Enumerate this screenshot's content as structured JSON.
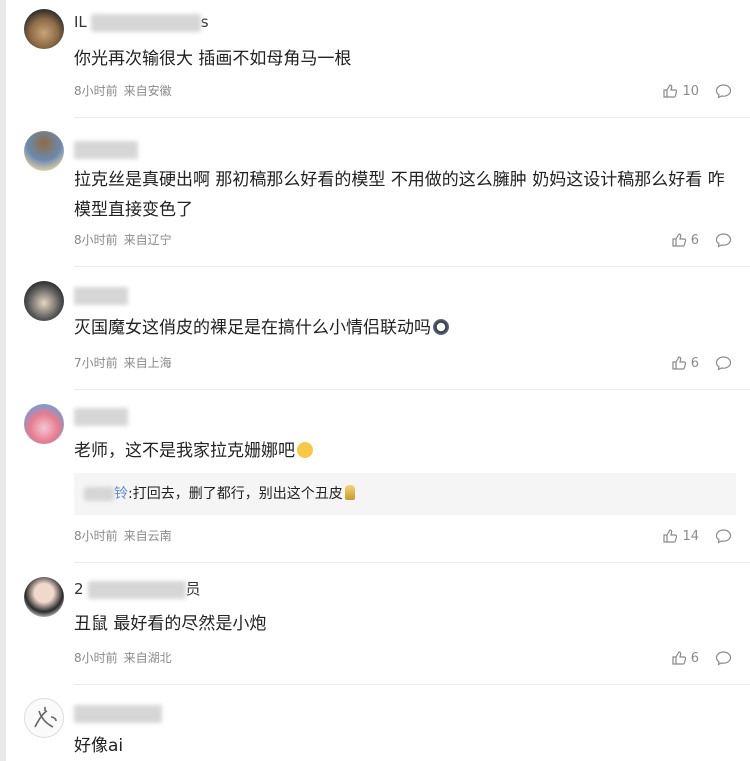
{
  "comments": [
    {
      "username": "IL…s",
      "text": "你光再次输很大 插画不如母角马一根",
      "time": "8小时前",
      "location": "来自安徽",
      "likes": "10"
    },
    {
      "username": "",
      "text": "拉克丝是真硬出啊 那初稿那么好看的模型 不用做的这么臃肿 奶妈这设计稿那么好看 咋模型直接变色了",
      "time": "8小时前",
      "location": "来自辽宁",
      "likes": "6"
    },
    {
      "username": "",
      "text": "灭国魔女这俏皮的裸足是在搞什么小情侣联动吗",
      "time": "7小时前",
      "location": "来自上海",
      "likes": "6"
    },
    {
      "username": "",
      "text": "老师，这不是我家拉克姗娜吧",
      "time": "8小时前",
      "location": "来自云南",
      "likes": "14",
      "reply": {
        "name": "铃",
        "text": ":打回去，删了都行，别出这个丑皮"
      }
    },
    {
      "username": "2…员",
      "text": "丑鼠 最好看的尽然是小炮",
      "time": "8小时前",
      "location": "来自湖北",
      "likes": "6"
    },
    {
      "username": "",
      "text": "好像ai",
      "time": "",
      "location": "",
      "likes": ""
    }
  ],
  "icons": {
    "like": "thumbs-up-icon",
    "reply": "comment-bubble-icon"
  },
  "colors": {
    "meta": "#8a8a8a",
    "reply_name": "#5f86c2",
    "reply_bg": "#f5f5f5",
    "divider": "#ececec"
  }
}
